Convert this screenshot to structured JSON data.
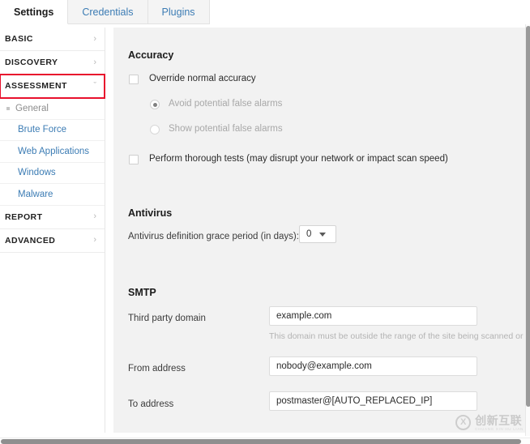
{
  "tabs": [
    {
      "label": "Settings",
      "active": true
    },
    {
      "label": "Credentials",
      "active": false
    },
    {
      "label": "Plugins",
      "active": false
    }
  ],
  "sidebar": {
    "groups": [
      {
        "label": "BASIC",
        "icon": "chevron-right-icon",
        "chevron": "›",
        "highlighted": false
      },
      {
        "label": "DISCOVERY",
        "icon": "chevron-right-icon",
        "chevron": "›",
        "highlighted": false
      },
      {
        "label": "ASSESSMENT",
        "icon": "chevron-down-icon",
        "chevron": "ˇ",
        "highlighted": true
      },
      {
        "label": "REPORT",
        "icon": "chevron-right-icon",
        "chevron": "›",
        "highlighted": false
      },
      {
        "label": "ADVANCED",
        "icon": "chevron-right-icon",
        "chevron": "›",
        "highlighted": false
      }
    ],
    "subitems": [
      {
        "label": "General",
        "current": true
      },
      {
        "label": "Brute Force",
        "current": false
      },
      {
        "label": "Web Applications",
        "current": false
      },
      {
        "label": "Windows",
        "current": false
      },
      {
        "label": "Malware",
        "current": false
      }
    ],
    "highlight_color": "#e8112d"
  },
  "content": {
    "accuracy": {
      "title": "Accuracy",
      "override_checkbox_label": "Override normal accuracy",
      "override_checked": false,
      "radios": [
        {
          "label": "Avoid potential false alarms",
          "selected": true
        },
        {
          "label": "Show potential false alarms",
          "selected": false
        }
      ],
      "thorough_checkbox_label": "Perform thorough tests (may disrupt your network or impact scan speed)",
      "thorough_checked": false
    },
    "antivirus": {
      "title": "Antivirus",
      "grace_period_label": "Antivirus definition grace period (in days):",
      "grace_period_value": "0"
    },
    "smtp": {
      "title": "SMTP",
      "third_party_domain_label": "Third party domain",
      "third_party_domain_value": "example.com",
      "third_party_domain_hint": "This domain must be outside the range of the site being scanned or th",
      "from_address_label": "From address",
      "from_address_value": "nobody@example.com",
      "to_address_label": "To address",
      "to_address_value": "postmaster@[AUTO_REPLACED_IP]"
    }
  },
  "watermark": {
    "mark": "X",
    "chinese": "创新互联",
    "pinyin": "CHUANG XIN HU LIAN"
  }
}
